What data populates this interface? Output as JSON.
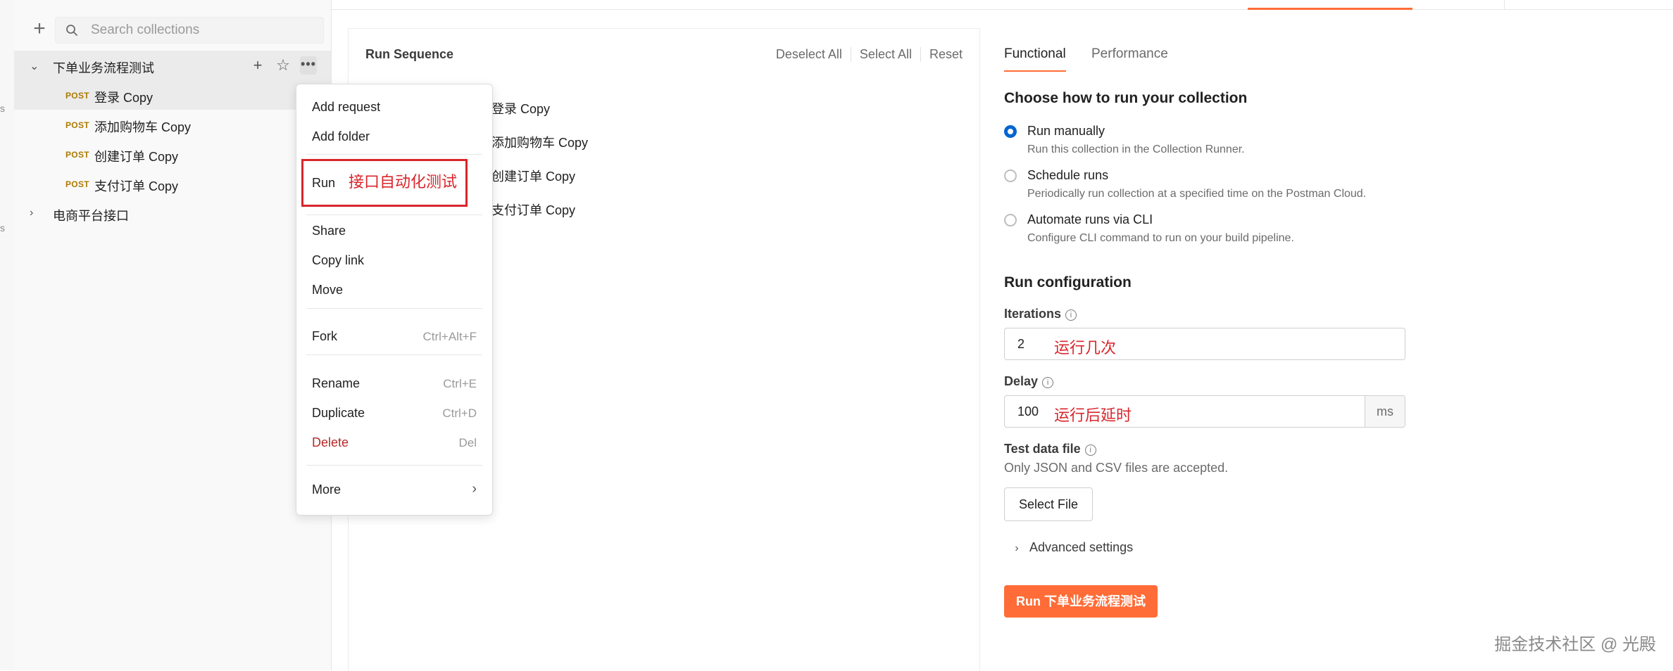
{
  "sidebar": {
    "search_placeholder": "Search collections",
    "collections": [
      {
        "name": "下单业务流程测试",
        "requests": [
          {
            "method": "POST",
            "name": "登录 Copy"
          },
          {
            "method": "POST",
            "name": "添加购物车 Copy"
          },
          {
            "method": "POST",
            "name": "创建订单 Copy"
          },
          {
            "method": "POST",
            "name": "支付订单 Copy"
          }
        ]
      },
      {
        "name": "电商平台接口"
      }
    ]
  },
  "context_menu": {
    "add_request": "Add request",
    "add_folder": "Add folder",
    "run": "Run",
    "run_annotation": "接口自动化测试",
    "share": "Share",
    "copy_link": "Copy link",
    "move": "Move",
    "fork": "Fork",
    "fork_shortcut": "Ctrl+Alt+F",
    "rename": "Rename",
    "rename_shortcut": "Ctrl+E",
    "duplicate": "Duplicate",
    "duplicate_shortcut": "Ctrl+D",
    "delete": "Delete",
    "delete_shortcut": "Del",
    "more": "More"
  },
  "run_sequence": {
    "title": "Run Sequence",
    "deselect_all": "Deselect All",
    "select_all": "Select All",
    "reset": "Reset",
    "items": [
      "登录 Copy",
      "添加购物车 Copy",
      "创建订单 Copy",
      "支付订单 Copy"
    ]
  },
  "runner": {
    "tabs": [
      "Functional",
      "Performance"
    ],
    "active_tab": "Functional",
    "heading": "Choose how to run your collection",
    "options": [
      {
        "label": "Run manually",
        "desc": "Run this collection in the Collection Runner.",
        "selected": true
      },
      {
        "label": "Schedule runs",
        "desc": "Periodically run collection at a specified time on the Postman Cloud.",
        "selected": false
      },
      {
        "label": "Automate runs via CLI",
        "desc": "Configure CLI command to run on your build pipeline.",
        "selected": false
      }
    ],
    "config_heading": "Run configuration",
    "iterations_label": "Iterations",
    "iterations_value": "2",
    "iterations_annotation": "运行几次",
    "delay_label": "Delay",
    "delay_value": "100",
    "delay_annotation": "运行后延时",
    "delay_unit": "ms",
    "test_data_label": "Test data file",
    "test_data_hint": "Only JSON and CSV files are accepted.",
    "select_file": "Select File",
    "advanced": "Advanced settings",
    "run_button": "Run 下单业务流程测试"
  },
  "colors": {
    "accent": "#ff6c37",
    "annotation": "#d9262c",
    "radio": "#0265d2",
    "method_post": "#ad7a03"
  },
  "watermark": "掘金技术社区 @ 光殿"
}
